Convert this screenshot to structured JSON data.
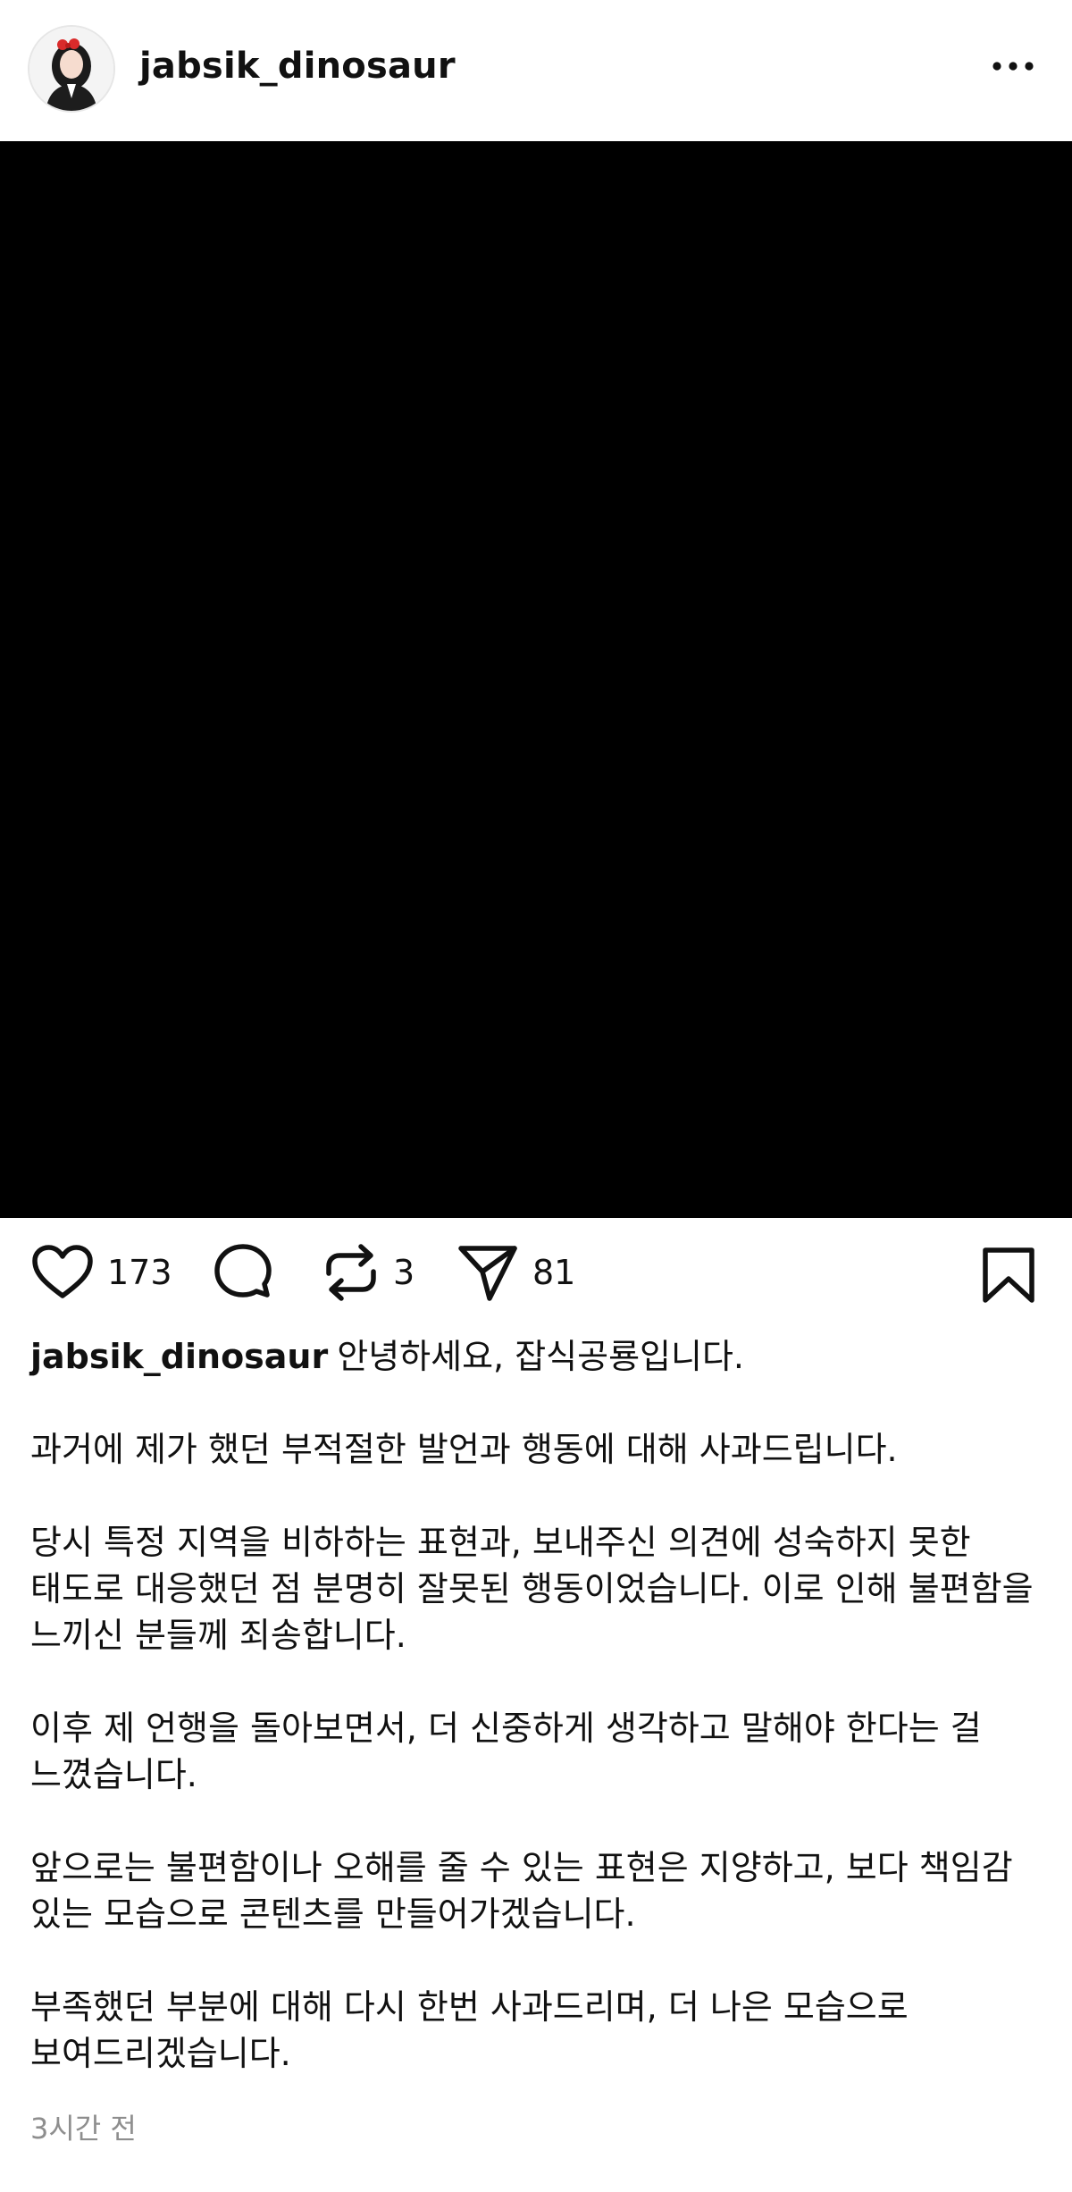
{
  "header": {
    "username": "jabsik_dinosaur",
    "avatar_icon": "profile-photo",
    "more_icon": "more-horizontal-icon"
  },
  "media": {
    "background": "#000000"
  },
  "actions": {
    "likes": "173",
    "reposts": "3",
    "shares": "81"
  },
  "caption": {
    "username": "jabsik_dinosaur",
    "first_line": "안녕하세요, 잡식공룡입니다.",
    "paragraphs": [
      "과거에 제가 했던 부적절한 발언과 행동에 대해 사과드립니다.",
      "당시 특정 지역을 비하하는 표현과, 보내주신 의견에 성숙하지 못한 태도로 대응했던 점 분명히 잘못된 행동이었습니다. 이로 인해 불편함을 느끼신 분들께 죄송합니다.",
      "이후 제 언행을 돌아보면서, 더 신중하게 생각하고 말해야 한다는 걸 느꼈습니다.",
      "앞으로는 불편함이나 오해를 줄 수 있는 표현은 지양하고, 보다 책임감 있는 모습으로 콘텐츠를 만들어가겠습니다.",
      "부족했던 부분에 대해 다시 한번 사과드리며, 더 나은 모습으로 보여드리겠습니다."
    ]
  },
  "timestamp": "3시간 전"
}
